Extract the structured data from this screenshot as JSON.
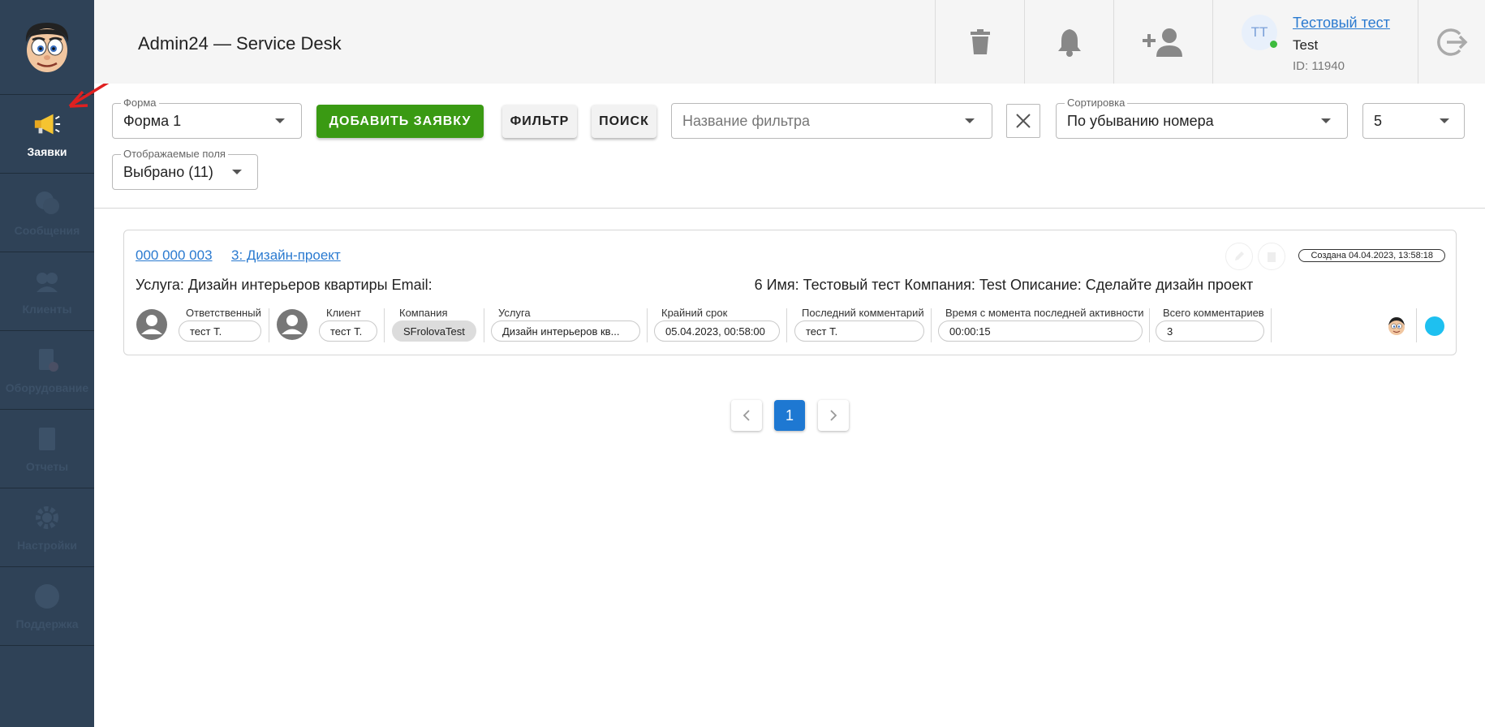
{
  "app": {
    "title": "Admin24 — Service Desk"
  },
  "sidebar": {
    "items": [
      {
        "label": "Заявки",
        "icon": "megaphone-icon",
        "active": true
      },
      {
        "label": "Сообщения",
        "icon": "chat-icon"
      },
      {
        "label": "Клиенты",
        "icon": "clients-icon"
      },
      {
        "label": "Оборудование",
        "icon": "equipment-icon"
      },
      {
        "label": "Отчеты",
        "icon": "reports-icon"
      },
      {
        "label": "Настройки",
        "icon": "gear-icon"
      },
      {
        "label": "Поддержка",
        "icon": "help-icon"
      }
    ]
  },
  "header": {
    "user": {
      "initials": "TT",
      "name": "Тестовый тест",
      "company": "Test",
      "id": "ID: 11940"
    }
  },
  "toolbar": {
    "form": {
      "label": "Форма",
      "value": "Форма 1"
    },
    "add_button": "ДОБАВИТЬ ЗАЯВКУ",
    "filter_button": "ФИЛЬТР",
    "search_button": "ПОИСК",
    "filter_name_placeholder": "Название фильтра",
    "sort": {
      "label": "Сортировка",
      "value": "По убыванию номера"
    },
    "per_page": "5",
    "fields": {
      "label": "Отображаемые поля",
      "value": "Выбрано (11)"
    }
  },
  "ticket": {
    "number": "000 000 003",
    "title": "3: Дизайн-проект",
    "created": "Создана 04.04.2023, 13:58:18",
    "description_start": "Услуга: Дизайн интерьеров квартиры Email:",
    "description_end": "6 Имя: Тестовый тест Компания: Test Описание: Сделайте дизайн проект",
    "fields": [
      {
        "label": "Ответственный",
        "value": "тест Т."
      },
      {
        "label": "Клиент",
        "value": "тест Т."
      },
      {
        "label": "Компания",
        "value": "SFrolovaTest"
      },
      {
        "label": "Услуга",
        "value": "Дизайн интерьеров кв..."
      },
      {
        "label": "Крайний срок",
        "value": "05.04.2023, 00:58:00"
      },
      {
        "label": "Последний комментарий",
        "value": "тест Т."
      },
      {
        "label": "Время с момента последней активности",
        "value": "00:00:15"
      },
      {
        "label": "Всего комментариев",
        "value": "3"
      }
    ],
    "status_color": "#1ec0f0"
  },
  "pagination": {
    "pages": [
      "1"
    ],
    "current": "1"
  },
  "colors": {
    "sidebar": "#2f4257",
    "accent": "#3a9a13",
    "link": "#2a7ad0",
    "page_active": "#1e78d2",
    "arrow": "#e02020"
  }
}
